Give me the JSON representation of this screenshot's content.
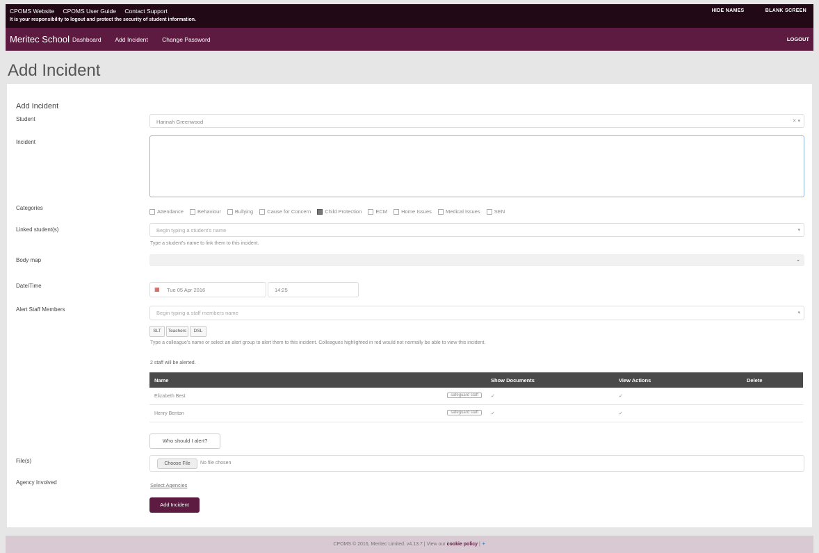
{
  "topbar": {
    "links": [
      "CPOMS Website",
      "CPOMS User Guide",
      "Contact Support"
    ],
    "warning": "It is your responsibility to logout and protect the security of student information.",
    "hide_names": "HIDE NAMES",
    "blank_screen": "BLANK SCREEN"
  },
  "navbar": {
    "brand": "Meritec School",
    "items": [
      "Dashboard",
      "Add Incident",
      "Change Password"
    ],
    "logout": "LOGOUT"
  },
  "page": {
    "title": "Add Incident",
    "form_title": "Add Incident"
  },
  "form": {
    "student_label": "Student",
    "student_value": "Hannah Greenwood",
    "incident_label": "Incident",
    "incident_value": "",
    "categories_label": "Categories",
    "categories": [
      {
        "label": "Attendance",
        "checked": false
      },
      {
        "label": "Behaviour",
        "checked": false
      },
      {
        "label": "Bullying",
        "checked": false
      },
      {
        "label": "Cause for Concern",
        "checked": false
      },
      {
        "label": "Child Protection",
        "checked": true
      },
      {
        "label": "ECM",
        "checked": false
      },
      {
        "label": "Home Issues",
        "checked": false
      },
      {
        "label": "Medical Issues",
        "checked": false
      },
      {
        "label": "SEN",
        "checked": false
      }
    ],
    "linked_label": "Linked student(s)",
    "linked_placeholder": "Begin typing a student's name",
    "linked_help": "Type a student's name to link them to this incident.",
    "bodymap_label": "Body map",
    "datetime_label": "Date/Time",
    "date_value": "Tue 05 Apr 2016",
    "time_value": "14:25",
    "alert_label": "Alert Staff Members",
    "alert_placeholder": "Begin typing a staff members name",
    "alert_groups": [
      "SLT",
      "Teachers",
      "DSL"
    ],
    "alert_help": "Type a colleague's name or select an alert group to alert them to this incident. Colleagues highlighted in red would not normally be able to view this incident.",
    "staff_count_text": "2 staff will be alerted.",
    "staff_table": {
      "headers": [
        "Name",
        "Show Documents",
        "View Actions",
        "Delete"
      ],
      "rows": [
        {
          "name": "Elizabeth Best",
          "tag": "safeguard staff"
        },
        {
          "name": "Henry Benton",
          "tag": "safeguard staff"
        }
      ]
    },
    "who_alert_button": "Who should I alert?",
    "files_label": "File(s)",
    "choose_file_button": "Choose File",
    "no_file_text": "No file chosen",
    "agency_label": "Agency Involved",
    "select_agencies_link": "Select Agencies",
    "submit_button": "Add Incident"
  },
  "footer": {
    "text": "CPOMS © 2016, Meritec Limited. v4.13.7 | View our",
    "cookie_link": "cookie policy",
    "sep": "|"
  }
}
